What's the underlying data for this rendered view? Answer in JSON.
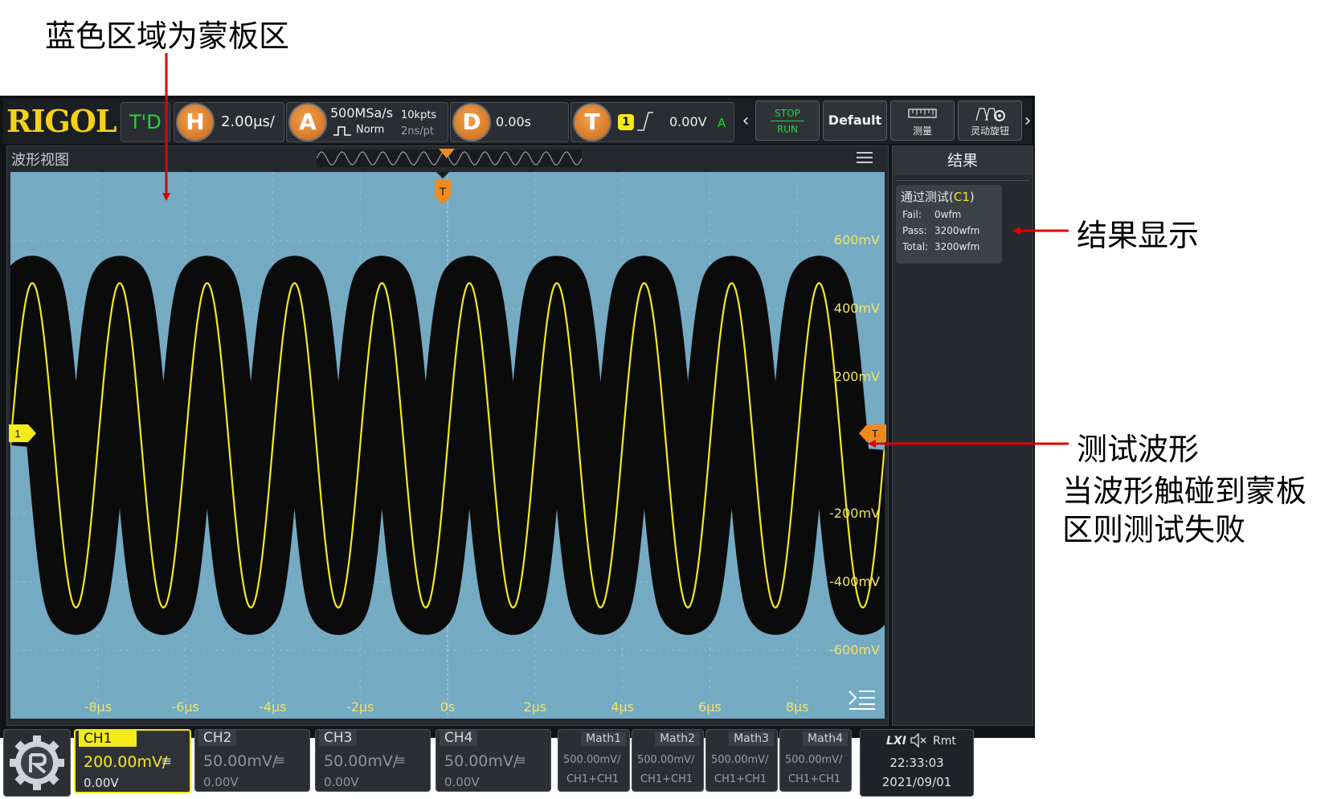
{
  "annotations": {
    "mask_area": "蓝色区域为蒙板区",
    "result_display": "结果显示",
    "test_waveform": "测试波形",
    "fail_line1": "当波形触碰到蒙板",
    "fail_line2": "区则测试失败"
  },
  "header": {
    "logo": "RIGOL",
    "td": "T'D",
    "h_label": "H",
    "timebase": "2.00μs/",
    "a_label": "A",
    "sample_rate": "500MSa/s",
    "acq_mode": "Norm",
    "mem_depth": "10kpts",
    "sample_interval": "2ns/pt",
    "d_label": "D",
    "delay": "0.00s",
    "t_label": "T",
    "trigger_source": "1",
    "trigger_level": "0.00V",
    "trigger_mode": "A",
    "stop": "STOP",
    "run": "RUN",
    "default": "Default",
    "measure": "测量",
    "knob": "灵动旋钮"
  },
  "waveform_view": {
    "title": "波形视图",
    "trigger_marker": "T",
    "channel_marker": "1",
    "level_marker": "T",
    "y_labels": [
      "600mV",
      "400mV",
      "200mV",
      "-200mV",
      "-400mV",
      "-600mV"
    ],
    "x_labels": [
      "-8μs",
      "-6μs",
      "-4μs",
      "-2μs",
      "0s",
      "2μs",
      "4μs",
      "6μs",
      "8μs"
    ]
  },
  "signal": {
    "cycles_on_screen": 10,
    "amplitude_mv": 475,
    "mask_half_width_mv": 80,
    "waveform_color": "#f4ea1c",
    "mask_color": "#75aac3"
  },
  "results": {
    "title": "结果",
    "test_title_prefix": "通过测试(",
    "test_channel": "C1",
    "test_title_suffix": ")",
    "fail_label": "Fail:",
    "fail_value": "0wfm",
    "pass_label": "Pass:",
    "pass_value": "3200wfm",
    "total_label": "Total:",
    "total_value": "3200wfm"
  },
  "channels": [
    {
      "name": "CH1",
      "scale": "200.00mV/",
      "offset": "0.00V"
    },
    {
      "name": "CH2",
      "scale": "50.00mV/",
      "offset": "0.00V"
    },
    {
      "name": "CH3",
      "scale": "50.00mV/",
      "offset": "0.00V"
    },
    {
      "name": "CH4",
      "scale": "50.00mV/",
      "offset": "0.00V"
    }
  ],
  "maths": [
    {
      "name": "Math1",
      "scale": "500.00mV/",
      "expr": "CH1+CH1"
    },
    {
      "name": "Math2",
      "scale": "500.00mV/",
      "expr": "CH1+CH1"
    },
    {
      "name": "Math3",
      "scale": "500.00mV/",
      "expr": "CH1+CH1"
    },
    {
      "name": "Math4",
      "scale": "500.00mV/",
      "expr": "CH1+CH1"
    }
  ],
  "status": {
    "lxi": "LXI",
    "rmt": "Rmt",
    "time": "22:33:03",
    "date": "2021/09/01"
  }
}
